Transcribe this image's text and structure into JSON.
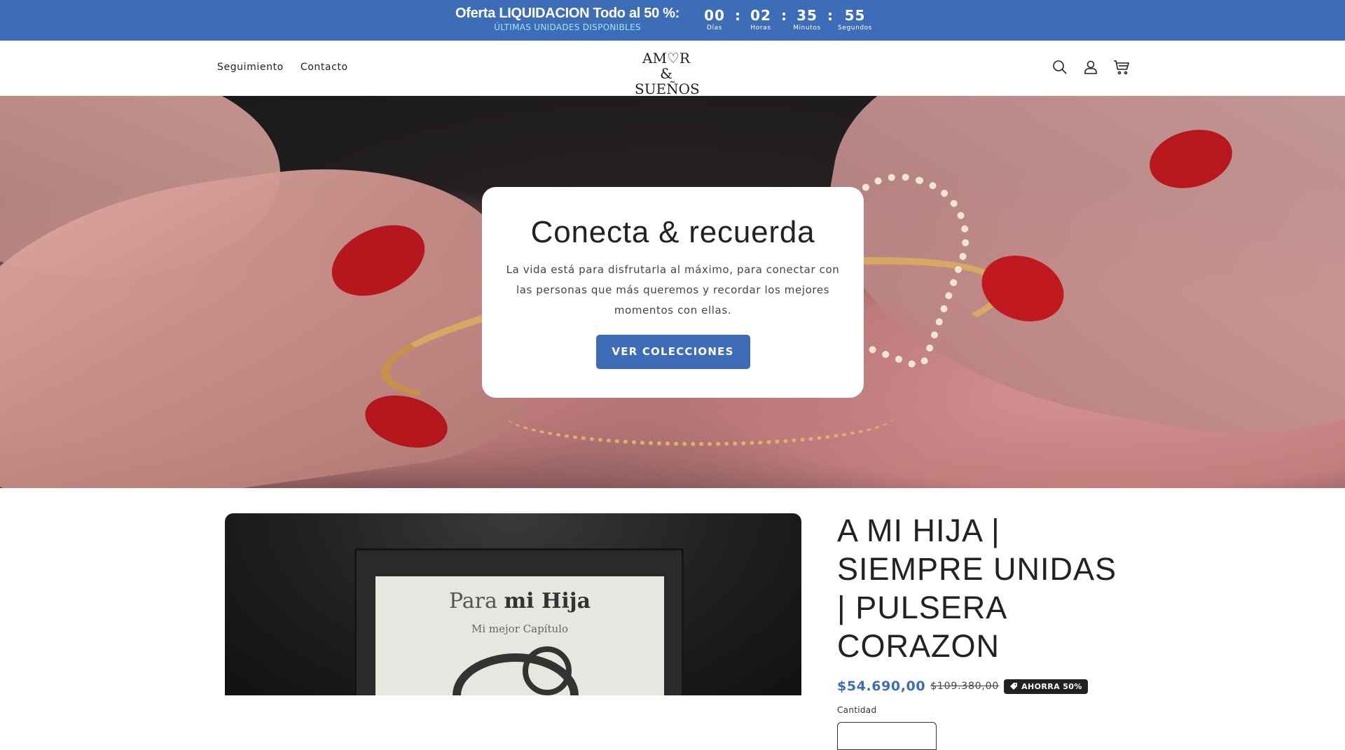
{
  "announcement": {
    "offer_title": "Oferta LIQUIDACION Todo al 50 %:",
    "offer_subtitle": "ÚLTIMAS UNIDADES DISPONIBLES",
    "countdown": [
      {
        "value": "00",
        "label": "Días"
      },
      {
        "value": "02",
        "label": "Horas"
      },
      {
        "value": "35",
        "label": "Minutos"
      },
      {
        "value": "55",
        "label": "Segundos"
      }
    ],
    "separator": ":"
  },
  "header": {
    "nav": [
      "Seguimiento",
      "Contacto"
    ],
    "logo_line1": "AM♡R &",
    "logo_line2": "SUEÑOS",
    "icons": [
      "search-icon",
      "account-icon",
      "cart-icon"
    ]
  },
  "hero": {
    "title": "Conecta & recuerda",
    "text": "La vida está para disfrutarla al máximo, para conectar con las personas que más queremos y recordar los mejores momentos con ellas.",
    "button": "VER COLECCIONES"
  },
  "product": {
    "title": "A MI HIJA | SIEMPRE UNIDAS | PULSERA CORAZON",
    "price": "$54.690,00",
    "compare_price": "$109.380,00",
    "badge": "AHORRA 50%",
    "quantity_label": "Cantidad",
    "image_text_1": "Para",
    "image_text_bold": "mi Hija",
    "image_text_2": "Mi mejor Capítulo"
  },
  "colors": {
    "accent": "#3e6db8",
    "badge_bg": "#222222"
  }
}
